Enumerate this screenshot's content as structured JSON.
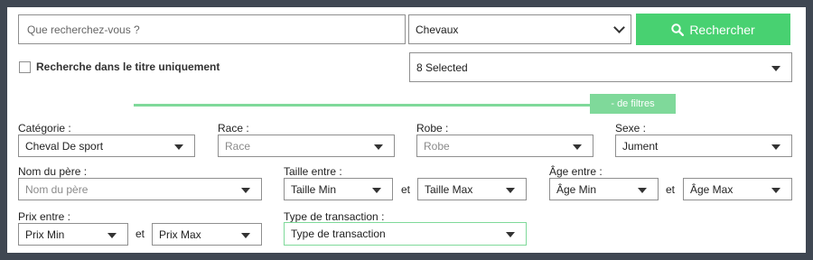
{
  "search": {
    "placeholder": "Que recherchez-vous ?",
    "value": ""
  },
  "category_select": {
    "value": "Chevaux"
  },
  "search_button": {
    "label": "Rechercher",
    "icon": "search-icon"
  },
  "title_only": {
    "label": "Recherche dans le titre uniquement",
    "checked": false
  },
  "multi_select": {
    "value": "8 Selected"
  },
  "filters_toggle": {
    "label": "- de filtres"
  },
  "colors": {
    "accent": "#48d171",
    "accent_light": "#7fd99a",
    "frame": "#3f4752"
  },
  "filters": {
    "categorie": {
      "label": "Catégorie :",
      "value": "Cheval De sport"
    },
    "race": {
      "label": "Race :",
      "value": "Race"
    },
    "robe": {
      "label": "Robe :",
      "value": "Robe"
    },
    "sexe": {
      "label": "Sexe :",
      "value": "Jument"
    },
    "pere": {
      "label": "Nom du père :",
      "value": "Nom du père"
    },
    "taille": {
      "label": "Taille entre :",
      "min": "Taille Min",
      "max": "Taille Max",
      "et": "et"
    },
    "age": {
      "label": "Âge entre :",
      "min": "Âge Min",
      "max": "Âge Max",
      "et": "et"
    },
    "prix": {
      "label": "Prix entre :",
      "min": "Prix Min",
      "max": "Prix Max",
      "et": "et"
    },
    "transaction": {
      "label": "Type de transaction :",
      "value": "Type de transaction"
    }
  }
}
